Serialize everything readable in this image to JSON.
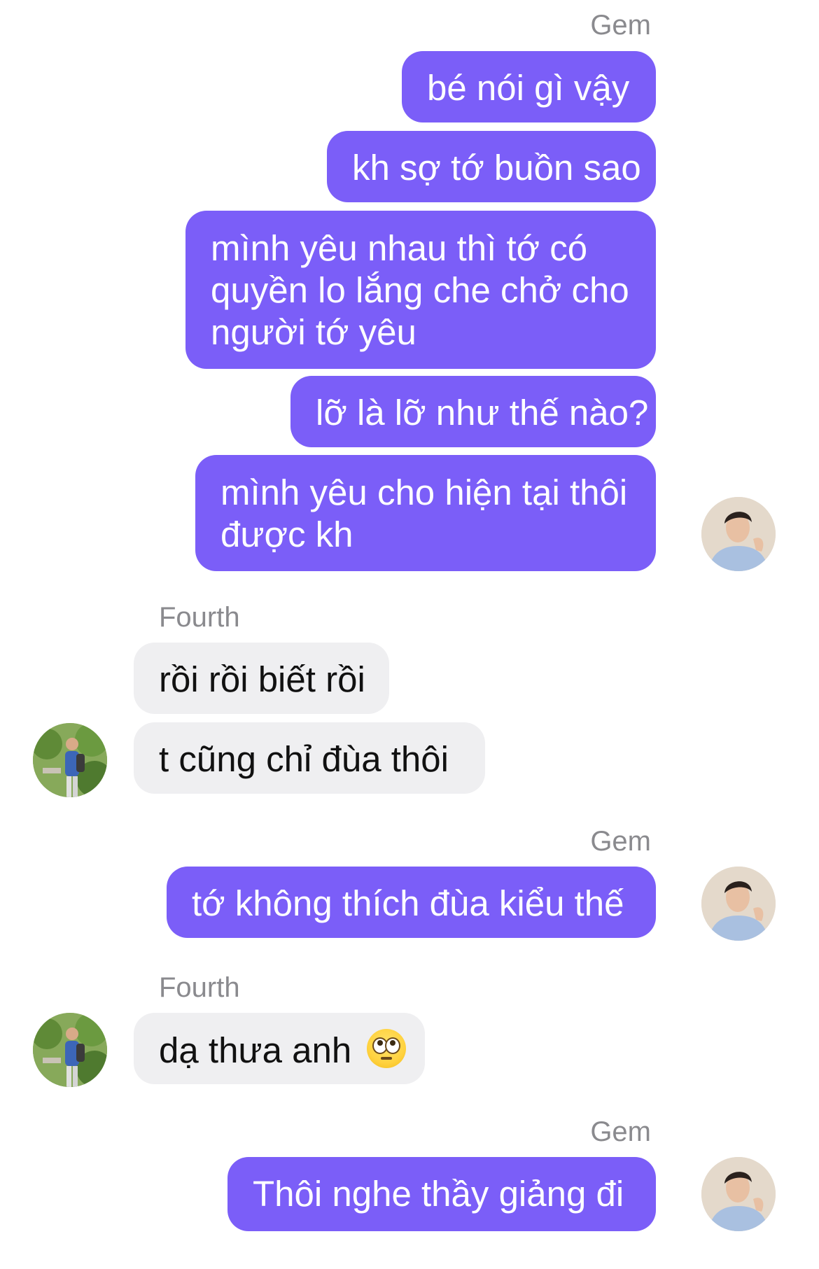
{
  "conversation": {
    "gem_name": "Gem",
    "fourth_name": "Fourth",
    "messages": [
      "bé nói gì vậy",
      "kh sợ tớ buồn sao",
      "mình yêu nhau thì tớ có quyền lo lắng che chở cho người tớ yêu",
      "lỡ là lỡ như thế nào?",
      "mình yêu cho hiện tại thôi được kh",
      "rồi rồi biết rồi",
      "t cũng chỉ đùa thôi",
      "tớ không thích đùa kiểu thế",
      "dạ thưa anh",
      "Thôi nghe thầy giảng đi"
    ]
  },
  "icons": {
    "eye_roll_emoji": "face-with-rolling-eyes-emoji",
    "gem_avatar": "gem-avatar",
    "fourth_avatar": "fourth-avatar"
  },
  "colors": {
    "outgoing_bubble": "#7b5ef8",
    "incoming_bubble": "#efeff1",
    "sender_name": "#8a8a8e"
  }
}
